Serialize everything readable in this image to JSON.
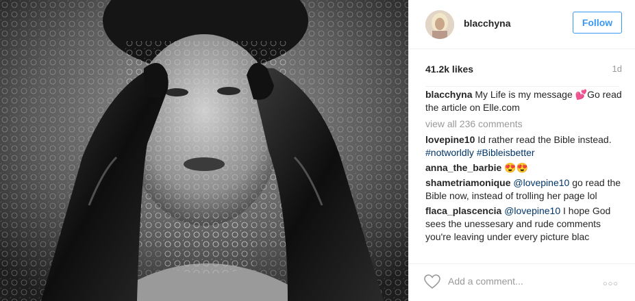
{
  "post": {
    "username": "blacchyna",
    "follow_label": "Follow",
    "likes": "41.2k likes",
    "time": "1d"
  },
  "caption": {
    "user": "blacchyna",
    "text_before_emoji": "My Life is my message ",
    "emoji": "💕",
    "text_after_emoji": "Go read the article on Elle.com"
  },
  "view_all": "view all 236 comments",
  "comments": [
    {
      "user": "lovepine10",
      "text": "Id rather read the Bible instead.",
      "tags": "#notworldly #Bibleisbetter"
    },
    {
      "user": "anna_the_barbie",
      "text": "😍😍"
    },
    {
      "user": "shametriamonique",
      "mention": "@lovepine10",
      "text": "go read the Bible now, instead of trolling her page lol"
    },
    {
      "user": "flaca_plascencia",
      "mention": "@lovepine10",
      "text": "I hope God sees the unessesary and rude comments you're leaving under every picture blac"
    }
  ],
  "composer": {
    "placeholder": "Add a comment...",
    "more": "○○○"
  },
  "colors": {
    "accent": "#3897f0",
    "link": "#003569",
    "muted": "#999999",
    "divider": "#efefef"
  },
  "icons": [
    "heart-icon",
    "more-options-icon",
    "avatar"
  ]
}
